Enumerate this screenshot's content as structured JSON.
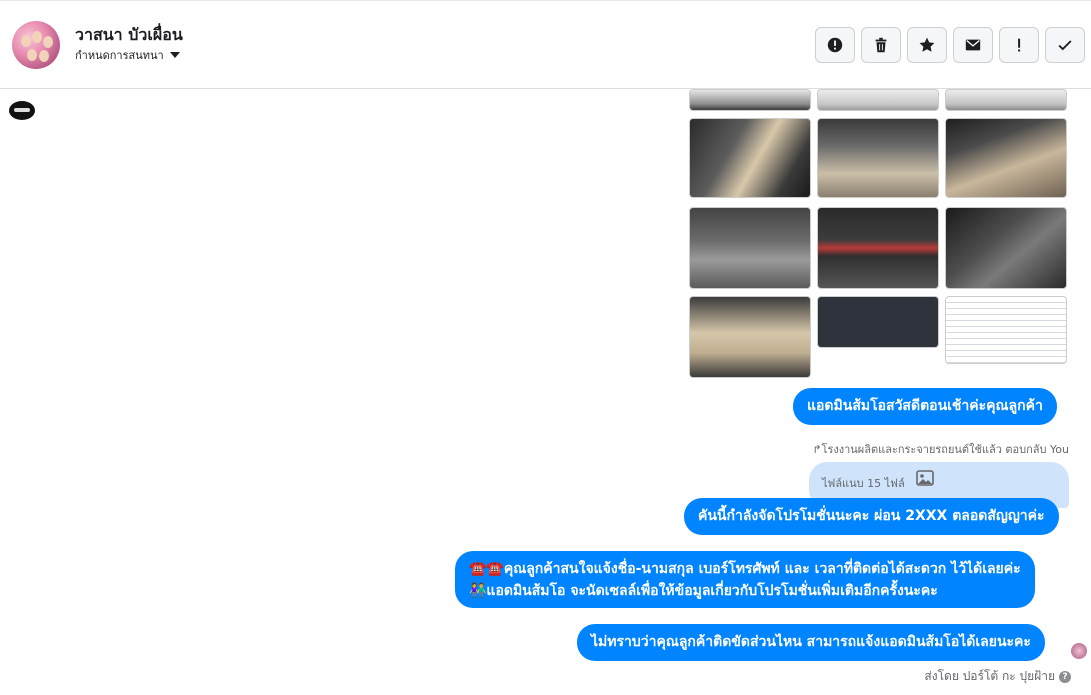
{
  "header": {
    "contact_name": "วาสนา บัวเผื่อน",
    "conversation_menu": "กำหนดการสนทนา",
    "toolbar": [
      {
        "name": "alert-circle-button",
        "icon": "alert-circle-icon"
      },
      {
        "name": "delete-button",
        "icon": "trash-icon"
      },
      {
        "name": "star-button",
        "icon": "star-icon"
      },
      {
        "name": "mail-button",
        "icon": "envelope-icon"
      },
      {
        "name": "important-button",
        "icon": "exclamation-icon"
      },
      {
        "name": "done-button",
        "icon": "checkmark-icon"
      }
    ]
  },
  "messages": [
    "แอดมินส้มโอสวัสดีตอนเช้าค่ะคุณลูกค้า",
    "คันนี้กำลังจัดโปรโมชั่นนะคะ ผ่อน 2XXX ตลอดสัญญาค่ะ",
    "☎️☎️คุณลูกค้าสนใจแจ้งชื่อ-นามสกุล เบอร์โทรศัพท์ และ เวลาที่ติดต่อได้สะดวก ไว้ได้เลยค่ะ",
    "👫แอดมินส้มโอ จะนัดเซลล์เพื่อให้ข้อมูลเกี่ยวกับโปรโมชั่นเพิ่มเติมอีกครั้งนะคะ",
    "ไม่ทราบว่าคุณลูกค้าติดขัดส่วนไหน สามารถแจ้งแอดมินส้มโอได้เลยนะคะ"
  ],
  "reply": {
    "label": "↱โรงงานผลิตและกระจายรถยนต์ใช้แล้ว ตอบกลับ You",
    "attachment_text": "ไฟล์แนบ 15 ไฟล์"
  },
  "footer": {
    "sent_by": "ส่งโดย ปอร์โต้ กะ ปุยฝ้าย"
  },
  "colors": {
    "bubble": "#0084ff",
    "reply_bubble": "#cfe4fb",
    "border": "#dadde1"
  }
}
